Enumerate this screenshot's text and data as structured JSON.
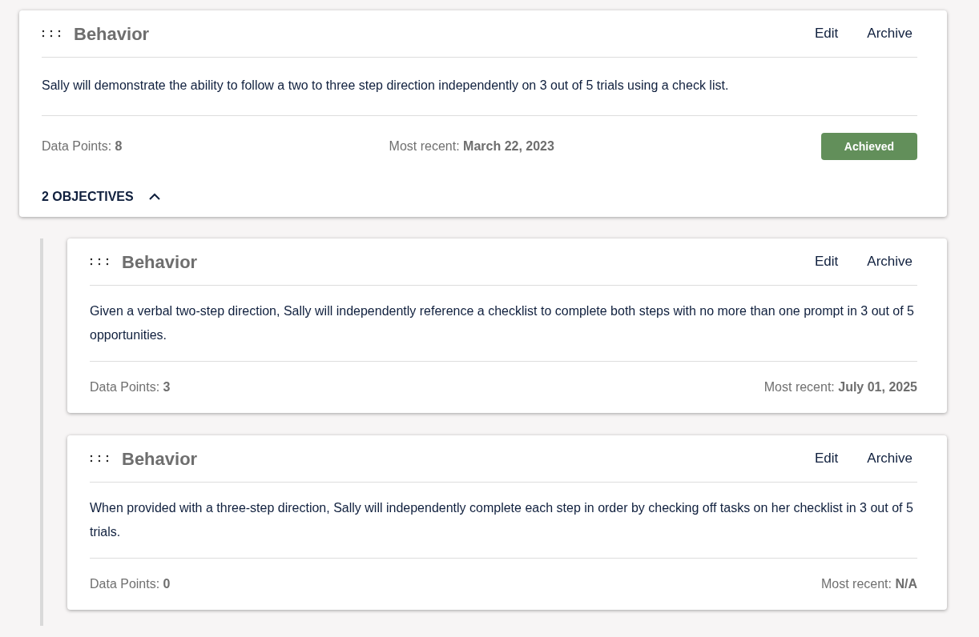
{
  "goal": {
    "category": "Behavior",
    "actions": [
      "Edit",
      "Archive"
    ],
    "description": "Sally will demonstrate the ability to follow a two to three step direction independently on 3 out of 5 trials using a check list.",
    "data_points": "Data Points: **8**",
    "most_recent": "Most recent: **March 22, 2023**",
    "status": "Achieved",
    "objectives_toggle": "2 OBJECTIVES",
    "expanded": true
  },
  "objectives": [
    {
      "category": "Behavior",
      "actions": [
        "Edit",
        "Archive"
      ],
      "description": "Given a verbal two-step direction, Sally will independently reference a checklist to complete both steps with no more than one prompt in 3 out of 5 opportunities.",
      "data_points": "Data Points: **3**",
      "most_recent": "Most recent: **July 01, 2025**"
    },
    {
      "category": "Behavior",
      "actions": [
        "Edit",
        "Archive"
      ],
      "description": "When provided with a three-step direction, Sally will independently complete each step in order by checking off tasks on her checklist in 3 out of 5 trials.",
      "data_points": "Data Points: **0**",
      "most_recent": "Most recent: **N/A**"
    }
  ]
}
